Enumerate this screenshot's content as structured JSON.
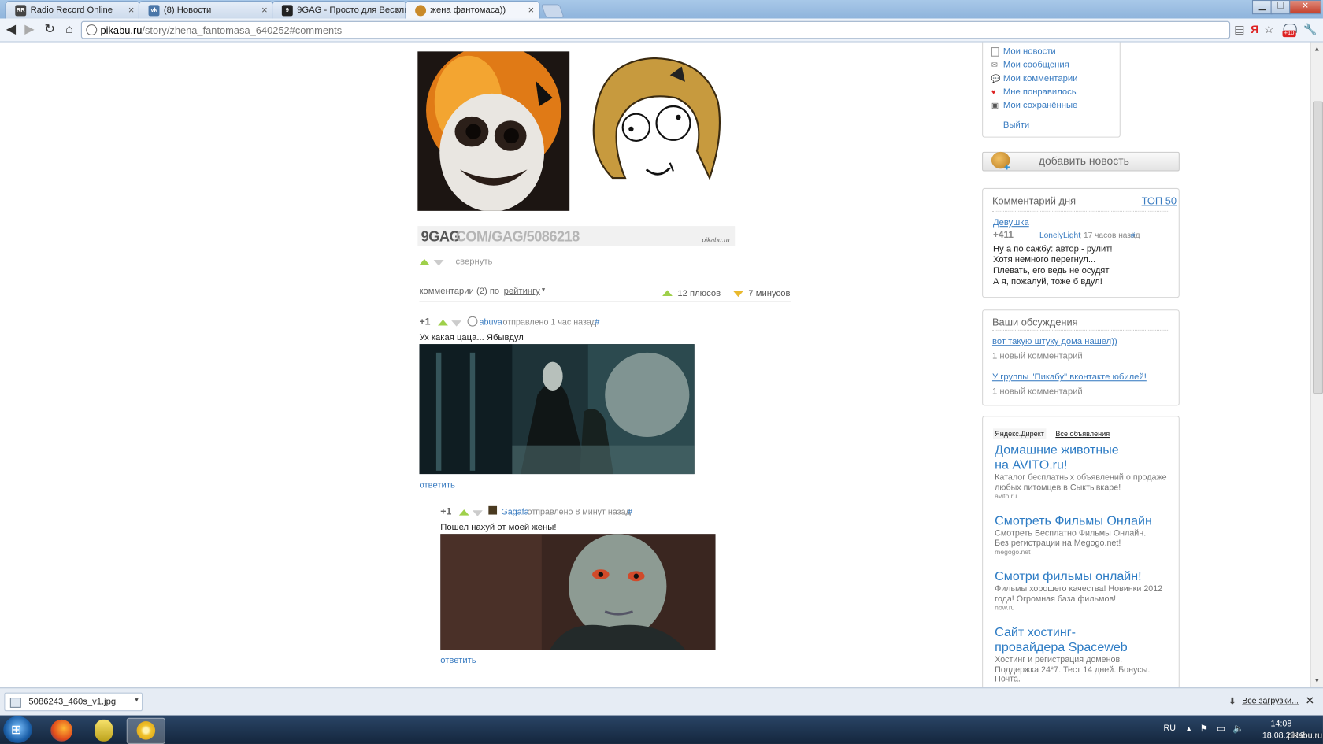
{
  "browser": {
    "tabs": [
      {
        "title": "Radio Record Online",
        "icon": "radio-record-icon",
        "active": false
      },
      {
        "title": "(8) Новости",
        "icon": "vk-icon",
        "active": false
      },
      {
        "title": "9GAG - Просто для Весель",
        "icon": "9gag-icon",
        "active": false
      },
      {
        "title": "жена фантомаса))",
        "icon": "pikabu-icon",
        "active": true
      }
    ],
    "url_host": "pikabu.ru",
    "url_path": "/story/zhena_fantomasa_640252#comments",
    "extension_badge": "+10"
  },
  "post": {
    "image_caption_left": "9GAG",
    "image_caption_right": ".COM/GAG/5086218",
    "watermark": "pikabu.ru",
    "collapse_label": "свернуть",
    "comments_label": "комментарии (2) по",
    "sort_label": "рейтингу",
    "pluses": "12 плюсов",
    "minuses": "7 минусов"
  },
  "comments": [
    {
      "score": "+1",
      "author": "abuva",
      "meta": "отправлено 1 час назад",
      "hash": "#",
      "text": "Ух какая цаца... Ябывдул",
      "reply": "ответить"
    },
    {
      "score": "+1",
      "author": "Gagafa",
      "meta": "отправлено 8 минут назад",
      "hash": "#",
      "text": "Пошел нахуй от моей жены!",
      "reply": "ответить"
    }
  ],
  "sidebar": {
    "menu": [
      {
        "label": "Мои новости",
        "icon": "news-icon"
      },
      {
        "label": "Мои сообщения",
        "icon": "envelope-icon"
      },
      {
        "label": "Мои комментарии",
        "icon": "comment-icon"
      },
      {
        "label": "Мне понравилось",
        "icon": "heart-icon"
      },
      {
        "label": "Мои сохранённые",
        "icon": "floppy-icon"
      }
    ],
    "logout": "Выйти",
    "add_news": "добавить новость",
    "comment_of_day": {
      "title": "Комментарий дня",
      "top_link": "ТОП 50",
      "story_link": "Девушка",
      "score": "+411",
      "author": "LonelyLight",
      "time": "; 17 часов назад",
      "hash": "#",
      "lines": [
        "Ну а по сажбу: автор - рулит!",
        "Хотя немного перегнул...",
        "Плевать, его ведь не осудят",
        "А я, пожалуй, тоже б вдул!"
      ]
    },
    "discussions": {
      "title": "Ваши обсуждения",
      "items": [
        {
          "link": "вот такую штуку дома нашел))",
          "count": "1 новый комментарий"
        },
        {
          "link": "У группы \"Пикабу\" вконтакте юбилей!",
          "count": "1 новый комментарий"
        }
      ]
    },
    "ads": {
      "label": "Яндекс.Директ",
      "all_link": "Все объявления",
      "items": [
        {
          "title": "Домашние животные на AVITO.ru!",
          "text": "Каталог бесплатных объявлений о продаже любых питомцев в Сыктывкаре!",
          "host": "avito.ru"
        },
        {
          "title": "Смотреть Фильмы Онлайн",
          "text": "Смотреть Бесплатно Фильмы Онлайн. Без регистрации на Megogo.net!",
          "host": "megogo.net"
        },
        {
          "title": "Смотри фильмы онлайн!",
          "text": "Фильмы хорошего качества! Новинки 2012 года! Огромная база фильмов!",
          "host": "now.ru"
        },
        {
          "title": "Сайт хостинг-провайдера Spaceweb",
          "text": "Хостинг и регистрация доменов. Поддержка 24*7. Тест 14 дней. Бонусы. Почта.",
          "host": ""
        }
      ]
    }
  },
  "downloads": {
    "file": "5086243_460s_v1.jpg",
    "all_label": "Все загрузки..."
  },
  "taskbar": {
    "lang": "RU",
    "time": "14:08",
    "date": "18.08.2012",
    "watermark": "pikabu.ru"
  },
  "colors": {
    "link": "#3a7cc1",
    "vote_up": "#9fd04a",
    "vote_down": "#e9b92e"
  }
}
